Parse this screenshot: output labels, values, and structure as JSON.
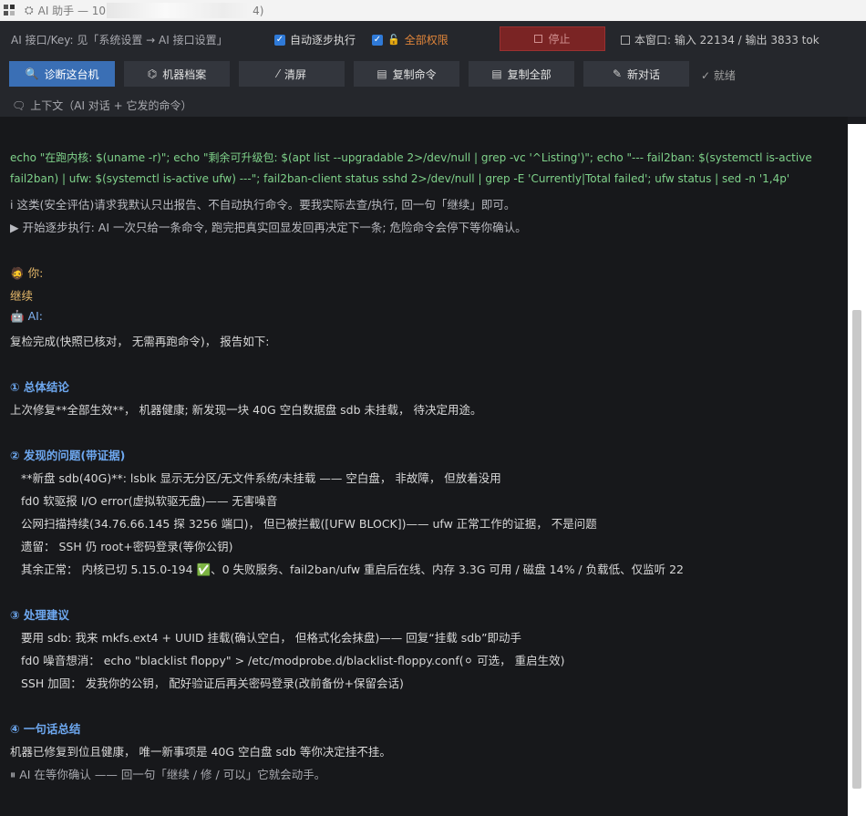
{
  "window": {
    "title_prefix": "AI 助手 — 10",
    "title_suffix": "4)"
  },
  "settings": {
    "api_hint": "AI 接口/Key: 见「系统设置 → AI 接口设置」",
    "auto_step_label": "自动逐步执行",
    "full_perm_label": "全部权限",
    "stop_label": "停止",
    "token_info": "本窗口: 输入 22134 / 输出 3833 tok"
  },
  "toolbar": {
    "diagnose": "诊断这台机",
    "profile": "机器档案",
    "clear": "清屏",
    "copy_cmd": "复制命令",
    "copy_all": "复制全部",
    "new_chat": "新对话",
    "status": "✓ 就绪"
  },
  "context": {
    "label": "上下文（AI 对话 + 它发的命令）"
  },
  "transcript": {
    "cmd_line1": "echo  \"在跑内核: $(uname -r)\"; echo \"剩余可升级包: $(apt list --upgradable 2>/dev/null | grep -vc '^Listing')\"; echo \"--- fail2ban: $(systemctl is-active",
    "cmd_line2": "fail2ban) | ufw: $(systemctl is-active ufw) ---\"; fail2ban-client status sshd 2>/dev/null | grep -E 'Currently|Total failed'; ufw status | sed -n '1,4p'",
    "info_line": "ⅰ 这类(安全评估)请求我默认只出报告、不自动执行命令。要我实际去查/执行, 回一句「继续」即可。",
    "start_line": "▶ 开始逐步执行: AI 一次只给一条命令, 跑完把真实回显发回再决定下一条; 危险命令会停下等你确认。",
    "you_label": "你:",
    "you_msg": "继续",
    "ai_label": "AI:",
    "ai_intro": "复检完成(快照已核对， 无需再跑命令)， 报告如下:",
    "h1": "① 总体结论",
    "h1_text": "上次修复**全部生效**， 机器健康; 新发现一块 40G 空白数据盘 sdb 未挂载， 待决定用途。",
    "h2": "② 发现的问题(带证据)",
    "h2_items": [
      "**新盘 sdb(40G)**: lsblk 显示无分区/无文件系统/未挂载 —— 空白盘， 非故障， 但放着没用",
      "fd0 软驱报 I/O error(虚拟软驱无盘)—— 无害噪音",
      "公网扫描持续(34.76.66.145 探 3256 端口)， 但已被拦截([UFW BLOCK])—— ufw 正常工作的证据， 不是问题",
      "遗留： SSH 仍 root+密码登录(等你公钥)",
      "其余正常： 内核已切 5.15.0-194 ✅、0 失败服务、fail2ban/ufw 重启后在线、内存 3.3G 可用 / 磁盘 14% / 负载低、仅监听 22"
    ],
    "h3": "③ 处理建议",
    "h3_items": [
      "要用 sdb: 我来 mkfs.ext4 + UUID 挂载(确认空白， 但格式化会抹盘)—— 回复“挂载 sdb”即动手",
      "fd0 噪音想消： echo \"blacklist floppy\" > /etc/modprobe.d/blacklist-floppy.conf(⚪ 可选， 重启生效)",
      "SSH 加固： 发我你的公钥， 配好验证后再关密码登录(改前备份+保留会话)"
    ],
    "h4": "④ 一句话总结",
    "h4_text": "机器已修复到位且健康， 唯一新事项是 40G 空白盘 sdb 等你决定挂不挂。",
    "wait_line": "⏸ AI 在等你确认 —— 回一句「继续 / 修 / 可以」它就会动手。"
  }
}
